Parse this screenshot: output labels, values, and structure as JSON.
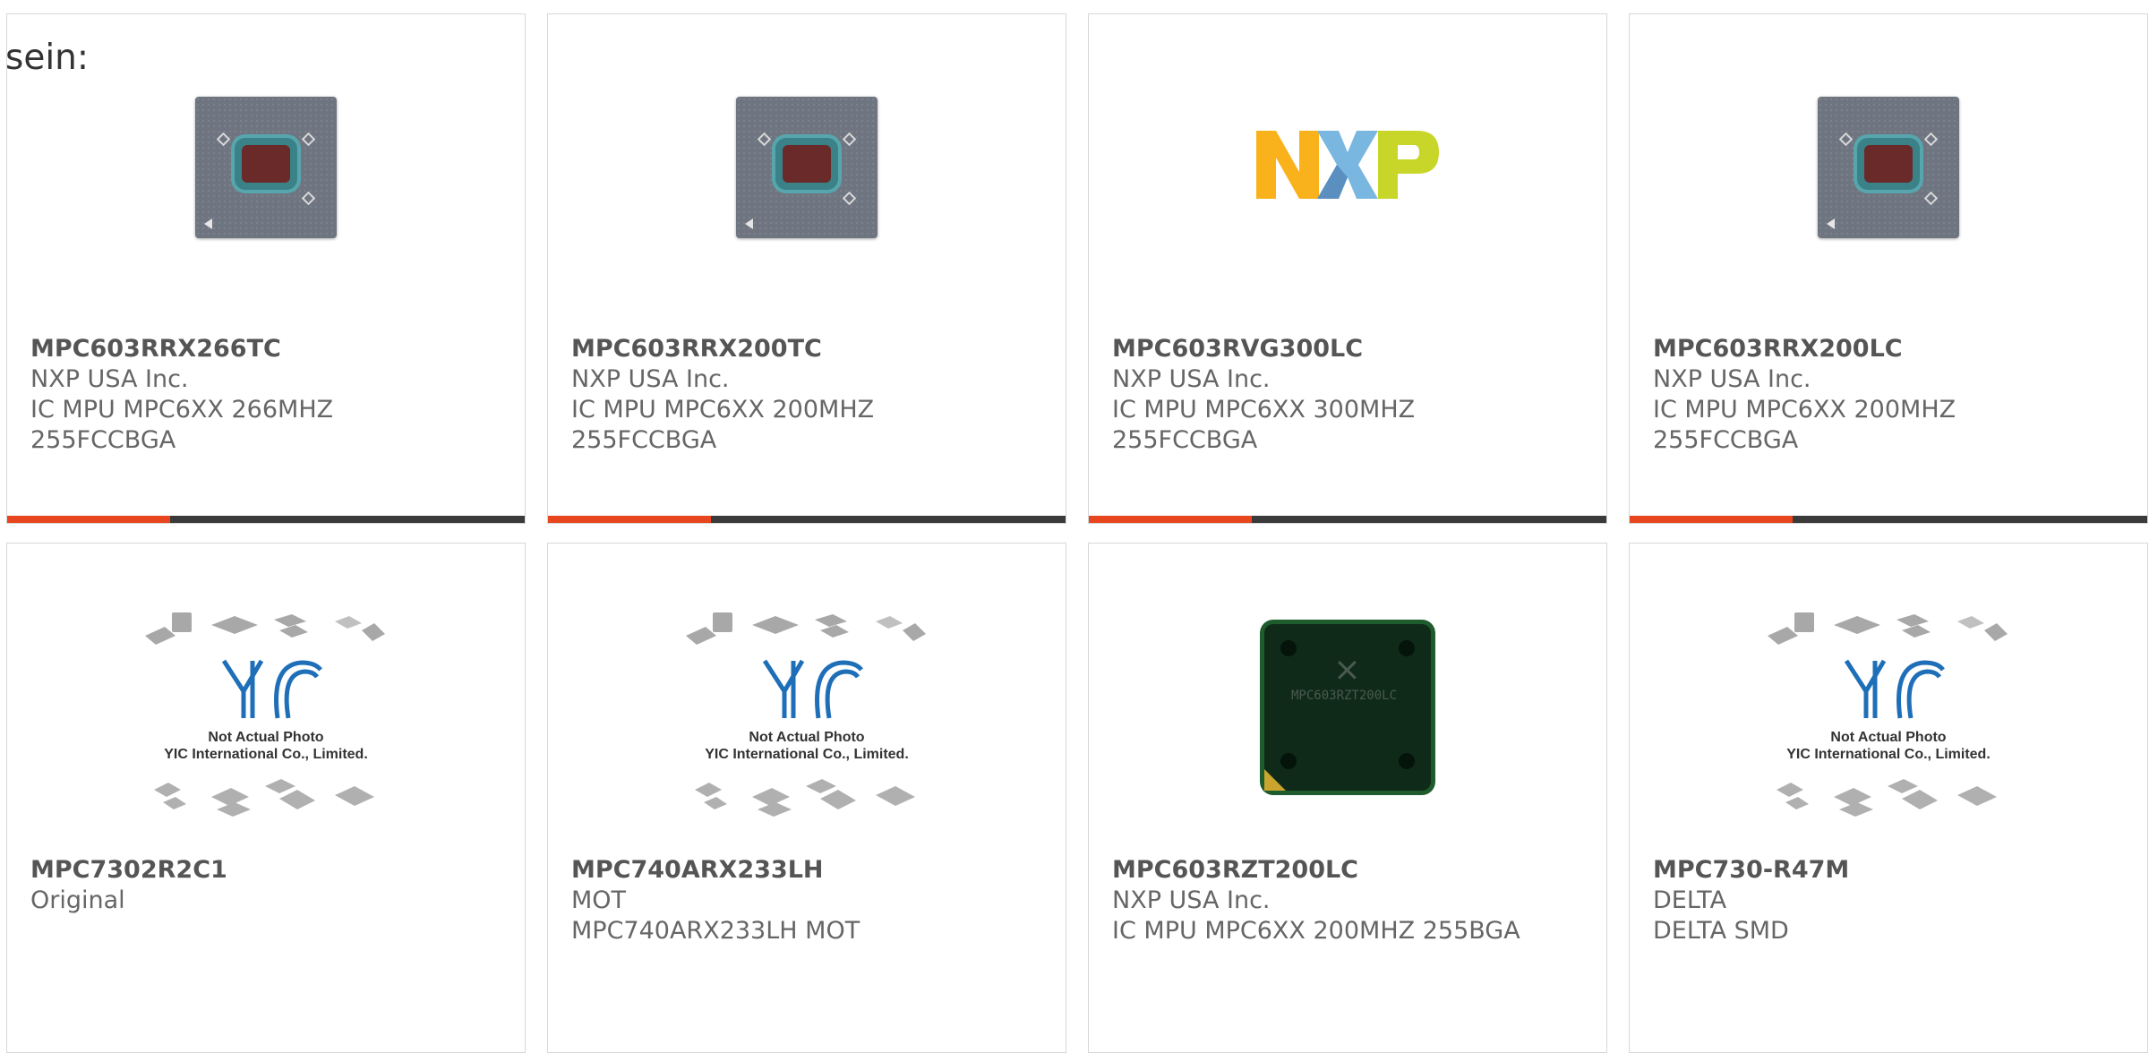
{
  "intro_text": "sein:",
  "colors": {
    "accent": "#e8461e",
    "bar": "#3a3a3a",
    "border": "#d7d7d7",
    "text": "#666666"
  },
  "products": [
    {
      "part": "MPC603RRX266TC",
      "lines": [
        "NXP USA Inc.",
        "IC MPU MPC6XX 266MHZ",
        "255FCCBGA"
      ],
      "image": "chip-image"
    },
    {
      "part": "MPC603RRX200TC",
      "lines": [
        "NXP USA Inc.",
        "IC MPU MPC6XX 200MHZ",
        "255FCCBGA"
      ],
      "image": "chip-image"
    },
    {
      "part": "MPC603RVG300LC",
      "lines": [
        "NXP USA Inc.",
        "IC MPU MPC6XX 300MHZ",
        "255FCCBGA"
      ],
      "image": "nxp-logo"
    },
    {
      "part": "MPC603RRX200LC",
      "lines": [
        "NXP USA Inc.",
        "IC MPU MPC6XX 200MHZ",
        "255FCCBGA"
      ],
      "image": "chip-image"
    },
    {
      "part": "MPC7302R2C1",
      "lines": [
        "Original"
      ],
      "image": "yic-placeholder"
    },
    {
      "part": "MPC740ARX233LH",
      "lines": [
        "MOT",
        "MPC740ARX233LH MOT"
      ],
      "image": "yic-placeholder"
    },
    {
      "part": "MPC603RZT200LC",
      "lines": [
        "NXP USA Inc.",
        "IC MPU MPC6XX 200MHZ 255BGA"
      ],
      "image": "bga-chip-image"
    },
    {
      "part": "MPC730-R47M",
      "lines": [
        "DELTA",
        "DELTA SMD"
      ],
      "image": "yic-placeholder"
    }
  ],
  "nxp_logo": {
    "letters": [
      "N",
      "X",
      "P"
    ]
  },
  "yic_placeholder": {
    "logo_text": "YIC",
    "caption_line1": "Not Actual Photo",
    "caption_line2": "YIC International Co., Limited."
  },
  "bga_marking": "MPC603RZT200LC"
}
